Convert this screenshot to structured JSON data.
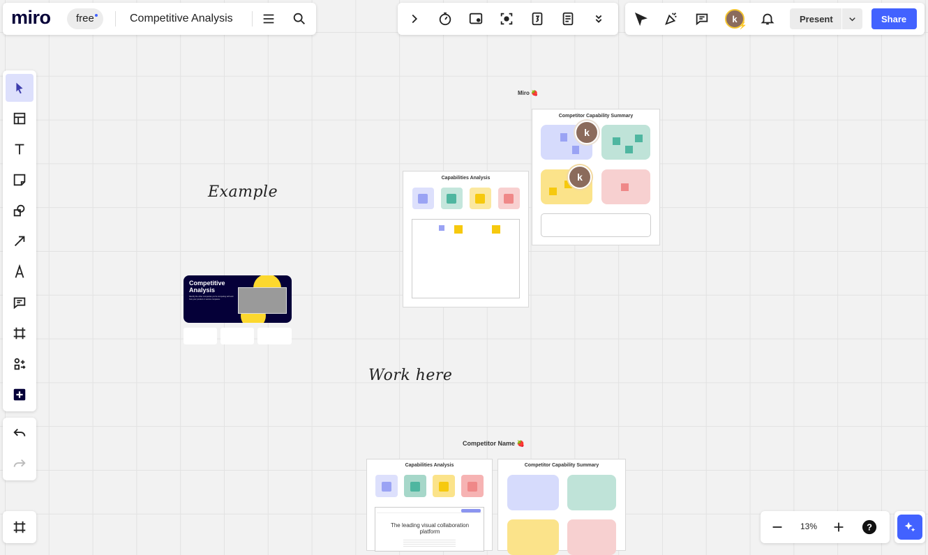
{
  "header": {
    "logo": "miro",
    "plan_badge": "free",
    "board_title": "Competitive Analysis"
  },
  "topbar": {
    "present_label": "Present",
    "share_label": "Share",
    "avatar_initial": "k"
  },
  "canvas": {
    "example_label": "Example",
    "work_here_label": "Work here",
    "miro_section_title": "Miro 🍓",
    "competitor_section_title": "Competitor Name 🍓",
    "example_frame": {
      "title": "Competitive Analysis",
      "subtitle": "Identify the other companies you're competing with and how your product or service compares."
    },
    "capabilities_frame_title": "Capabilities Analysis",
    "summary_frame_title": "Competitor Capability Summary",
    "collab_text": "The leading visual collaboration platform",
    "cursor_initial": "k"
  },
  "zoom": {
    "level": "13%"
  },
  "colors": {
    "brand": "#050038",
    "accent": "#4262ff",
    "blue_sticky": "#c6cdfb",
    "green_sticky": "#a6d7c9",
    "yellow_sticky": "#fbe38a",
    "red_sticky": "#f6b3b3"
  },
  "icons": [
    "chevron-right-icon",
    "timer-icon",
    "screen-icon",
    "focus-icon",
    "counter-icon",
    "notes-icon",
    "chevron-double-down-icon",
    "cursor-icon",
    "celebrate-icon",
    "comment-icon",
    "bell-icon",
    "select-icon",
    "templates-icon",
    "text-icon",
    "sticky-note-icon",
    "shapes-icon",
    "arrow-icon",
    "pen-icon",
    "comment-tool-icon",
    "frame-icon",
    "more-apps-icon",
    "add-icon",
    "undo-icon",
    "redo-icon",
    "frames-panel-icon",
    "zoom-out-icon",
    "zoom-in-icon",
    "help-icon",
    "ai-assist-icon",
    "menu-icon",
    "search-icon"
  ]
}
